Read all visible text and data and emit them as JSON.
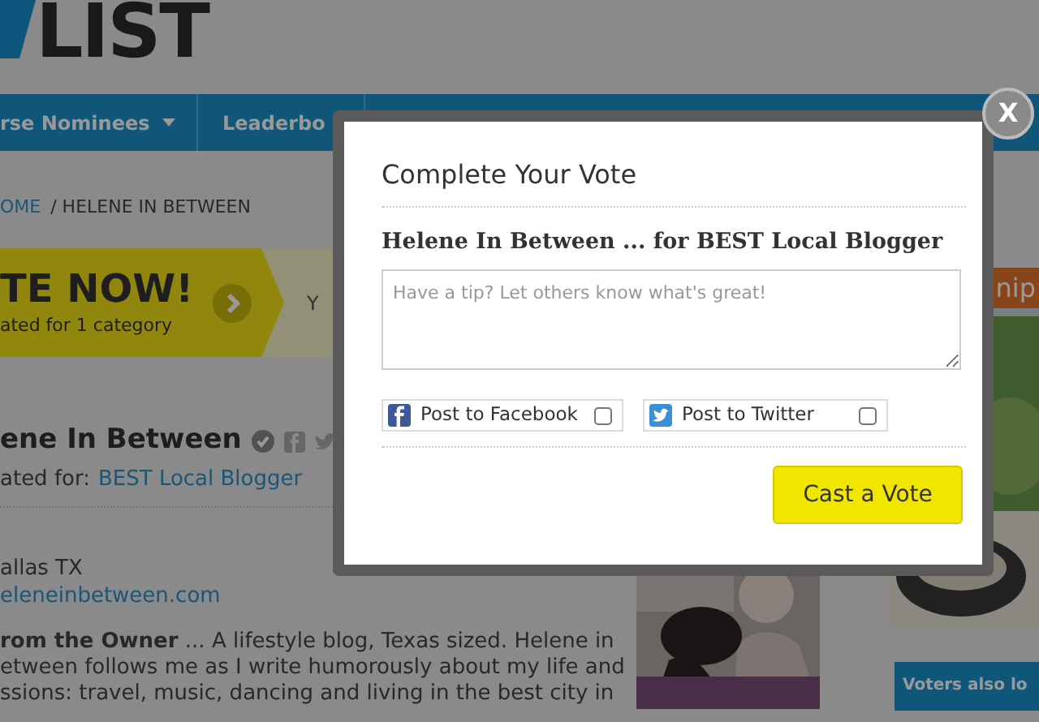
{
  "logo": {
    "text": "LIST"
  },
  "nav": [
    {
      "label": "rse Nominees",
      "dropdown": true
    },
    {
      "label": "Leaderbo",
      "dropdown": false
    }
  ],
  "breadcrumb": [
    {
      "label": "OME",
      "kind": "link"
    },
    {
      "label": "/ HELENE IN BETWEEN",
      "kind": "current"
    }
  ],
  "vote_banner": {
    "title": "TE NOW!",
    "subtitle": "ated for 1 category",
    "side_text": "Y"
  },
  "listing": {
    "title": "ene In Between",
    "verified": true,
    "nominated_label": "ated for:",
    "category": "BEST Local Blogger",
    "location": "allas TX",
    "website": "eleneinbetween.com",
    "description_lines": [
      "**rom the Owner** ... A lifestyle blog, Texas sized. Helene in",
      "etween follows me as I write humorously about my life and",
      "ssions: travel, music, dancing and living in the best city in"
    ]
  },
  "sidebar": {
    "banner_text": "nip",
    "voters_heading": "Voters also lo"
  },
  "modal": {
    "close": "X",
    "title": "Complete Your Vote",
    "heading": "Helene In Between ... for BEST Local Blogger",
    "comment": {
      "placeholder": "Have a tip? Let others know what's great!"
    },
    "share_options": [
      {
        "kind": "facebook",
        "label": "Post to Facebook",
        "checked": false
      },
      {
        "kind": "twitter",
        "label": "Post to Twitter",
        "checked": false
      }
    ],
    "submit": "Cast a Vote"
  }
}
